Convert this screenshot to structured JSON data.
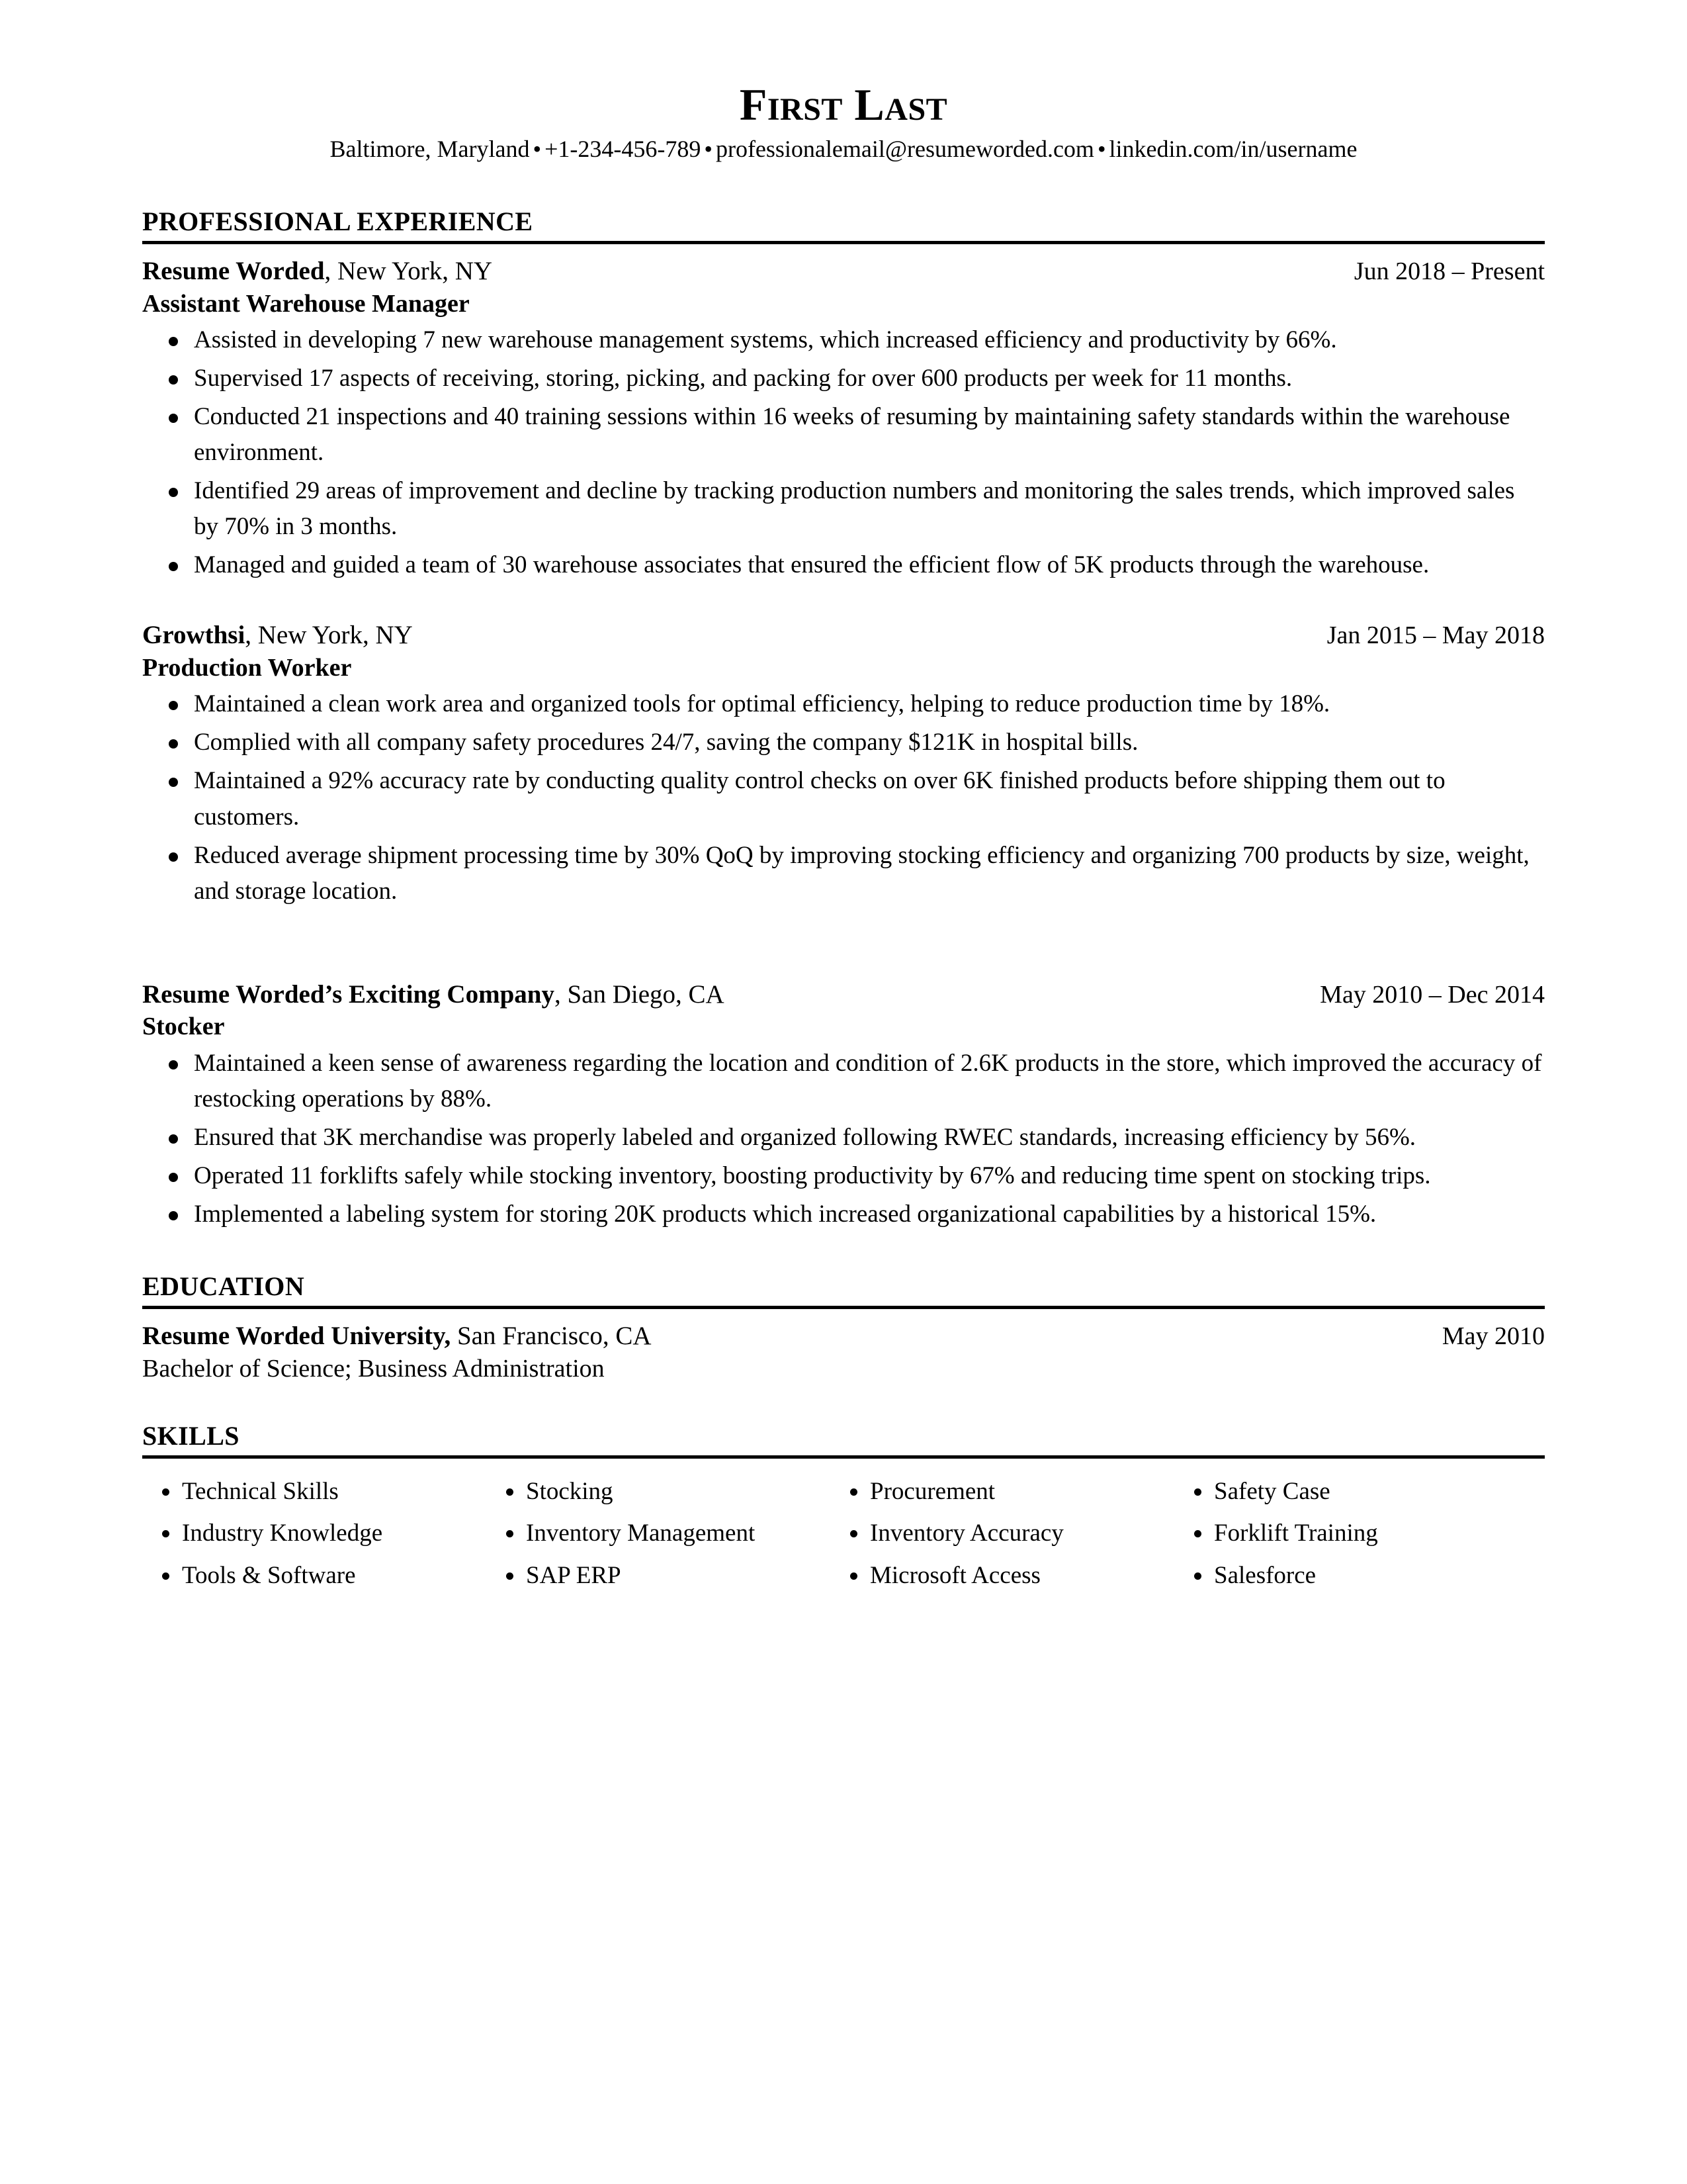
{
  "header": {
    "name": "First Last",
    "contact": {
      "location": "Baltimore, Maryland",
      "phone": "+1-234-456-789",
      "email": "professionalemail@resumeworded.com",
      "linkedin": "linkedin.com/in/username",
      "separator": "•"
    }
  },
  "sections": {
    "experience": {
      "title": "PROFESSIONAL EXPERIENCE",
      "jobs": [
        {
          "company": "Resume Worded",
          "location": ", New York, NY",
          "dates": "Jun 2018 – Present",
          "role": "Assistant Warehouse Manager",
          "bullets": [
            "Assisted in developing 7 new warehouse management systems, which increased efficiency and productivity by 66%.",
            "Supervised 17 aspects of receiving, storing, picking, and packing for over 600 products per week for 11 months.",
            "Conducted 21 inspections and 40 training sessions within 16 weeks of resuming by maintaining safety standards within the warehouse environment.",
            "Identified 29 areas of improvement and decline by tracking production numbers and monitoring the sales trends, which improved sales by 70% in 3 months.",
            "Managed and guided a team of 30 warehouse associates that ensured the efficient flow of 5K products through the warehouse."
          ]
        },
        {
          "company": "Growthsi",
          "location": ", New York, NY",
          "dates": "Jan 2015 – May 2018",
          "role": "Production Worker",
          "bullets": [
            "Maintained a clean work area and organized tools for optimal efficiency, helping to reduce production time by 18%.",
            "Complied with all company safety procedures 24/7, saving the company $121K in hospital bills.",
            "Maintained a 92% accuracy rate by conducting quality control checks on over 6K finished products before shipping them out to customers.",
            "Reduced average shipment processing time by 30% QoQ by improving stocking efficiency and organizing 700 products by size, weight, and storage location."
          ]
        },
        {
          "company": "Resume Worded’s Exciting Company",
          "location": ", San Diego, CA",
          "dates": "May 2010 – Dec 2014",
          "role": "Stocker",
          "bullets": [
            "Maintained a keen sense of awareness regarding the location and condition of 2.6K products in the store, which improved the accuracy of restocking operations by 88%.",
            "Ensured that 3K merchandise was properly labeled and organized following RWEC standards, increasing efficiency by 56%.",
            "Operated 11 forklifts safely while stocking inventory, boosting productivity by 67% and reducing time spent on stocking trips.",
            "Implemented a labeling system for storing 20K products which increased organizational capabilities by a historical 15%."
          ]
        }
      ]
    },
    "education": {
      "title": "EDUCATION",
      "entries": [
        {
          "school": "Resume Worded University,",
          "location": " San Francisco, CA",
          "dates": "May 2010",
          "degree": "Bachelor of Science; Business Administration"
        }
      ]
    },
    "skills": {
      "title": "SKILLS",
      "items": [
        "Technical Skills",
        "Stocking",
        "Procurement",
        "Safety Case",
        "Industry Knowledge",
        "Inventory Management",
        "Inventory Accuracy",
        "Forklift Training",
        "Tools & Software",
        "SAP ERP",
        "Microsoft Access",
        "Salesforce"
      ]
    }
  }
}
